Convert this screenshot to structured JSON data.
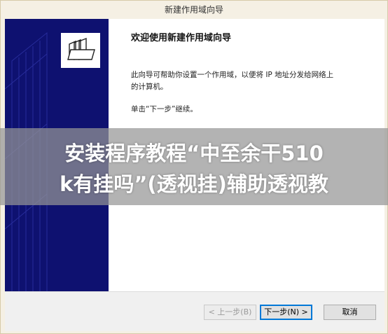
{
  "window": {
    "title": "新建作用域向导"
  },
  "wizard": {
    "heading": "欢迎使用新建作用域向导",
    "paragraph_line1": "此向导可帮助你设置一个作用域，以便将 IP 地址分发给网络上",
    "paragraph_line2": "的计算机。",
    "instruction": "单击“下一步”继续。",
    "panel_icon": "folders-icon"
  },
  "buttons": {
    "back_label": "< 上一步(B)",
    "next_label": "下一步(N) >",
    "cancel_label": "取消"
  },
  "overlay": {
    "line1": "安装程序教程“中至余干510",
    "line2": "k有挂吗”(透视挂)辅助透视教"
  },
  "colors": {
    "side_panel": "#0e1170",
    "overlay": "#969696",
    "accent": "#0078d7"
  }
}
